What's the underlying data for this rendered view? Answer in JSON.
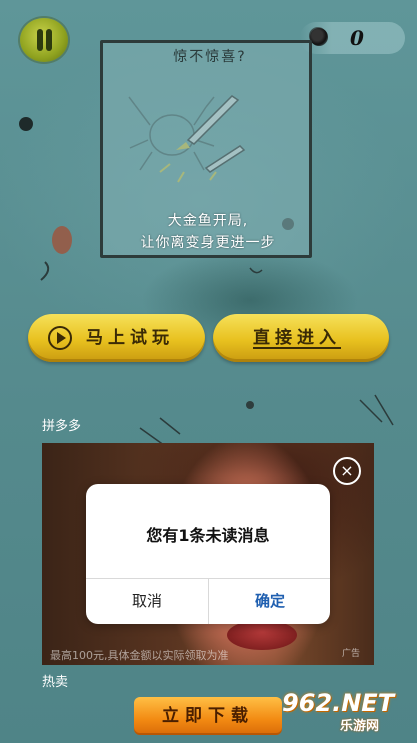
{
  "score": {
    "value": "0"
  },
  "tutorial": {
    "title": "惊不惊喜?",
    "line1": "大金鱼开局,",
    "line2": "让你离变身更进一步"
  },
  "buttons": {
    "play_trial": "马上试玩",
    "enter_direct": "直接进入"
  },
  "ad": {
    "source": "拼多多",
    "footer": "最高100元,具体金额以实际领取为准",
    "ad_mark": "广告",
    "close_glyph": "×"
  },
  "dialog": {
    "message": "您有1条未读消息",
    "cancel": "取消",
    "confirm": "确定"
  },
  "bottom": {
    "hot_label": "热卖",
    "download": "立即下载"
  },
  "watermark": {
    "main": "962.NET",
    "sub": "乐游网"
  },
  "colors": {
    "background": "#5a8f92",
    "button_yellow": "#e8c11f",
    "download_orange": "#f28a12",
    "dialog_confirm": "#1f5fb0"
  }
}
